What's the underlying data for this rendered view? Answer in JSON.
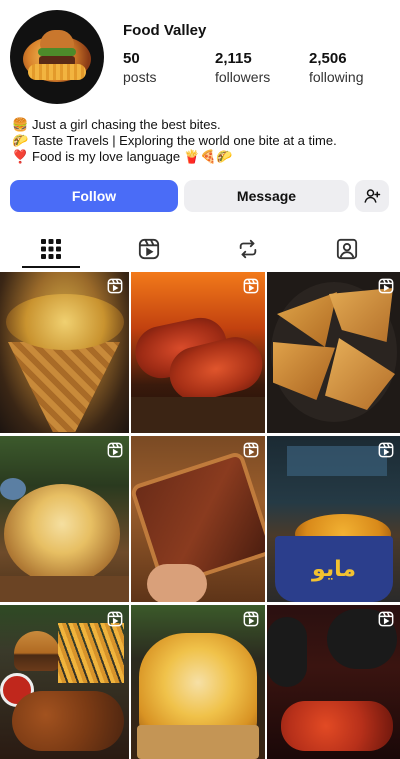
{
  "profile": {
    "username": "Food Valley",
    "stats": [
      {
        "value": "50",
        "label": "posts"
      },
      {
        "value": "2,115",
        "label": "followers"
      },
      {
        "value": "2,506",
        "label": "following"
      }
    ],
    "bio": [
      {
        "emoji": "🍔",
        "text": "Just a girl chasing the best bites."
      },
      {
        "emoji": "🌮",
        "text": "Taste Travels | Exploring the world one bite at a time."
      },
      {
        "emoji": "❣️",
        "text": "Food is my love language 🍟🍕🌮"
      }
    ]
  },
  "actions": {
    "follow_label": "Follow",
    "message_label": "Message"
  },
  "tabs": [
    "grid-icon",
    "reels-icon",
    "reposts-icon",
    "tagged-icon"
  ],
  "grid": {
    "tiles": [
      {
        "name": "loaded-fries-cone",
        "reel": true
      },
      {
        "name": "grilled-hotdogs",
        "reel": true
      },
      {
        "name": "pizza-slices",
        "reel": true
      },
      {
        "name": "bread-bowl-cheese",
        "reel": true
      },
      {
        "name": "saucy-toast",
        "reel": true
      },
      {
        "name": "fries-bucket-maybo",
        "reel": true
      },
      {
        "name": "burger-wings-platter",
        "reel": true
      },
      {
        "name": "cheesy-fries",
        "reel": true
      },
      {
        "name": "spicy-wings",
        "reel": true
      }
    ],
    "bucket_text": "مايو"
  },
  "colors": {
    "accent": "#4a6cf7",
    "button_gray": "#eeeef1"
  }
}
